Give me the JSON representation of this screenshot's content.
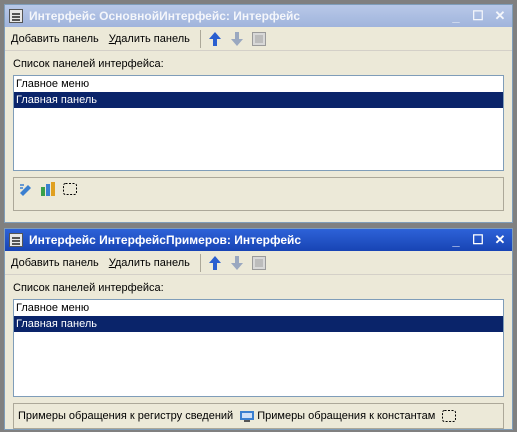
{
  "window1": {
    "title": "Интерфейс ОсновнойИнтерфейс: Интерфейс",
    "toolbar": {
      "add_prefix": "Д",
      "add_rest": "обавить панель",
      "remove_prefix": "У",
      "remove_rest": "далить панель"
    },
    "list_label": "Список панелей интерфейса:",
    "items": [
      "Главное меню",
      "Главная панель"
    ],
    "selected_index": 1
  },
  "window2": {
    "title": "Интерфейс ИнтерфейсПримеров: Интерфейс",
    "toolbar": {
      "add_prefix": "Д",
      "add_rest": "обавить панель",
      "remove_prefix": "У",
      "remove_rest": "далить панель"
    },
    "list_label": "Список панелей интерфейса:",
    "items": [
      "Главное меню",
      "Главная панель"
    ],
    "selected_index": 1,
    "panel_buttons": [
      "Примеры обращения к регистру сведений",
      "Примеры обращения к константам"
    ]
  },
  "icons": {
    "up": "arrow-up-icon",
    "down": "arrow-down-icon",
    "props": "properties-icon",
    "minimize": "minimize-icon",
    "maximize": "maximize-icon",
    "close": "close-icon"
  },
  "colors": {
    "selection": "#0a246a",
    "active_title": "#1844b4",
    "inactive_title": "#a0b4dc",
    "arrow_active": "#2a5fd0",
    "arrow_inactive": "#9aa8c0"
  }
}
